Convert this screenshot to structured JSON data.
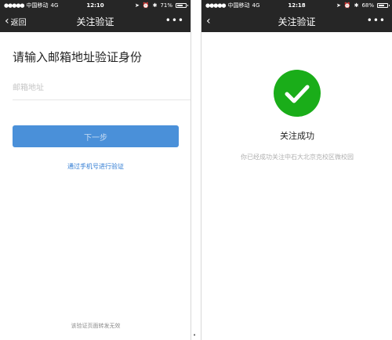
{
  "left": {
    "status": {
      "carrier": "中国移动",
      "network": "4G",
      "time": "12:10",
      "battery_percent": "71%",
      "battery_level": 0.71
    },
    "nav": {
      "back_label": "返回",
      "title": "关注验证",
      "more": "•••"
    },
    "heading": "请输入邮箱地址验证身份",
    "email_placeholder": "邮箱地址",
    "email_value": "",
    "next_button": "下一步",
    "phone_link": "通过手机号进行验证",
    "footer_note": "该验证页面转发无效"
  },
  "right": {
    "status": {
      "carrier": "中国移动",
      "network": "4G",
      "time": "12:18",
      "battery_percent": "68%",
      "battery_level": 0.68
    },
    "nav": {
      "back_label": "",
      "title": "关注验证",
      "more": "•••"
    },
    "success_title": "关注成功",
    "success_desc": "你已经成功关注中石大北京克校区微校园"
  },
  "bottom_mark": "•",
  "colors": {
    "bar": "#262626",
    "accent_blue": "#4a90d9",
    "link_blue": "#2f7bd3",
    "success_green": "#1aad19"
  },
  "icons": {
    "back": "chevron-left-icon",
    "more": "more-dots-icon",
    "success": "checkmark-icon",
    "signal": "signal-dots-icon",
    "alarm": "alarm-icon",
    "bluetooth": "bluetooth-icon",
    "location": "location-arrow-icon"
  }
}
